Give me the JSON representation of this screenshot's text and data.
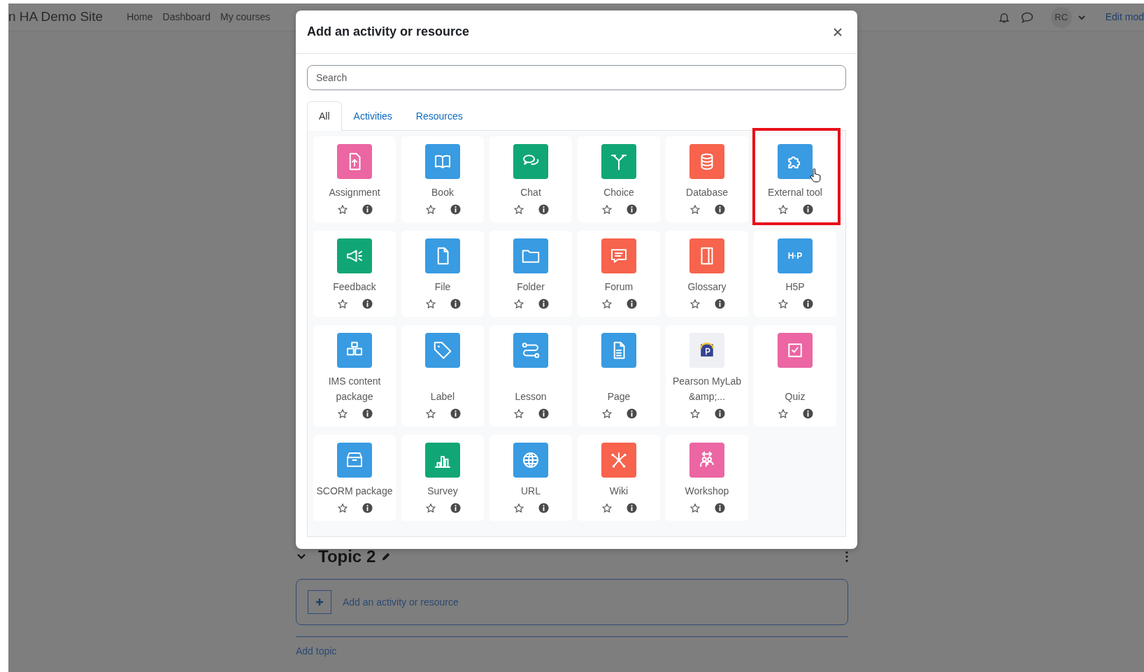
{
  "navbar": {
    "site_name": "n HA Demo Site",
    "links": [
      "Home",
      "Dashboard",
      "My courses"
    ],
    "avatar": "RC",
    "edit_mode": "Edit mod"
  },
  "modal": {
    "title": "Add an activity or resource",
    "search": {
      "placeholder": "Search"
    },
    "tabs": [
      {
        "label": "All",
        "selected": true
      },
      {
        "label": "Activities",
        "selected": false
      },
      {
        "label": "Resources",
        "selected": false
      }
    ],
    "items": [
      {
        "name": "Assignment",
        "kind": "assignment",
        "color": "#eb66a2",
        "highlighted": false,
        "hovered": false
      },
      {
        "name": "Book",
        "kind": "book",
        "color": "#399be2",
        "highlighted": false,
        "hovered": false
      },
      {
        "name": "Chat",
        "kind": "chat",
        "color": "#11a676",
        "highlighted": false,
        "hovered": false
      },
      {
        "name": "Choice",
        "kind": "choice",
        "color": "#11a676",
        "highlighted": false,
        "hovered": false
      },
      {
        "name": "Database",
        "kind": "database",
        "color": "#f7634d",
        "highlighted": false,
        "hovered": false
      },
      {
        "name": "External tool",
        "kind": "puzzle",
        "color": "#399be2",
        "highlighted": true,
        "hovered": true
      },
      {
        "name": "Feedback",
        "kind": "megaphone",
        "color": "#11a676",
        "highlighted": false,
        "hovered": false
      },
      {
        "name": "File",
        "kind": "file",
        "color": "#399be2",
        "highlighted": false,
        "hovered": false
      },
      {
        "name": "Folder",
        "kind": "folder",
        "color": "#399be2",
        "highlighted": false,
        "hovered": false
      },
      {
        "name": "Forum",
        "kind": "forum",
        "color": "#f7634d",
        "highlighted": false,
        "hovered": false
      },
      {
        "name": "Glossary",
        "kind": "glossary",
        "color": "#f7634d",
        "highlighted": false,
        "hovered": false
      },
      {
        "name": "H5P",
        "kind": "h5p",
        "color": "#399be2",
        "icon_text": "H·P",
        "highlighted": false,
        "hovered": false
      },
      {
        "name": "IMS content package",
        "kind": "ims",
        "color": "#399be2",
        "highlighted": false,
        "hovered": false
      },
      {
        "name": "Label",
        "kind": "tag",
        "color": "#399be2",
        "highlighted": false,
        "hovered": false
      },
      {
        "name": "Lesson",
        "kind": "lesson",
        "color": "#399be2",
        "highlighted": false,
        "hovered": false
      },
      {
        "name": "Page",
        "kind": "page",
        "color": "#399be2",
        "highlighted": false,
        "hovered": false
      },
      {
        "name": "Pearson MyLab &amp;...",
        "kind": "pearson",
        "color": "#eef0f4",
        "highlighted": false,
        "hovered": false
      },
      {
        "name": "Quiz",
        "kind": "quiz",
        "color": "#eb66a2",
        "highlighted": false,
        "hovered": false
      },
      {
        "name": "SCORM package",
        "kind": "box",
        "color": "#399be2",
        "highlighted": false,
        "hovered": false
      },
      {
        "name": "Survey",
        "kind": "chart",
        "color": "#11a676",
        "highlighted": false,
        "hovered": false
      },
      {
        "name": "URL",
        "kind": "globe",
        "color": "#399be2",
        "highlighted": false,
        "hovered": false
      },
      {
        "name": "Wiki",
        "kind": "wiki",
        "color": "#f7634d",
        "highlighted": false,
        "hovered": false
      },
      {
        "name": "Workshop",
        "kind": "workshop",
        "color": "#eb66a2",
        "highlighted": false,
        "hovered": false
      }
    ]
  },
  "course": {
    "section_title": "Topic 2",
    "add_activity": "Add an activity or resource",
    "add_topic": "Add topic"
  }
}
